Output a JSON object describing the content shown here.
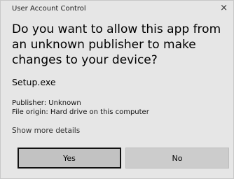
{
  "window": {
    "title": "User Account Control",
    "close_symbol": "×"
  },
  "prompt": {
    "heading": "Do you want to allow this app from an unknown publisher to make changes to your device?"
  },
  "app": {
    "name": "Setup.exe",
    "publisher": "Publisher: Unknown",
    "origin": "File origin: Hard drive on this computer"
  },
  "details_link": "Show more details",
  "buttons": {
    "yes": "Yes",
    "no": "No"
  },
  "icons": {
    "close": "close-icon"
  },
  "colors": {
    "dialog_background": "#e6e6e6",
    "button_background": "#cccccc",
    "focus_border": "#111111"
  }
}
